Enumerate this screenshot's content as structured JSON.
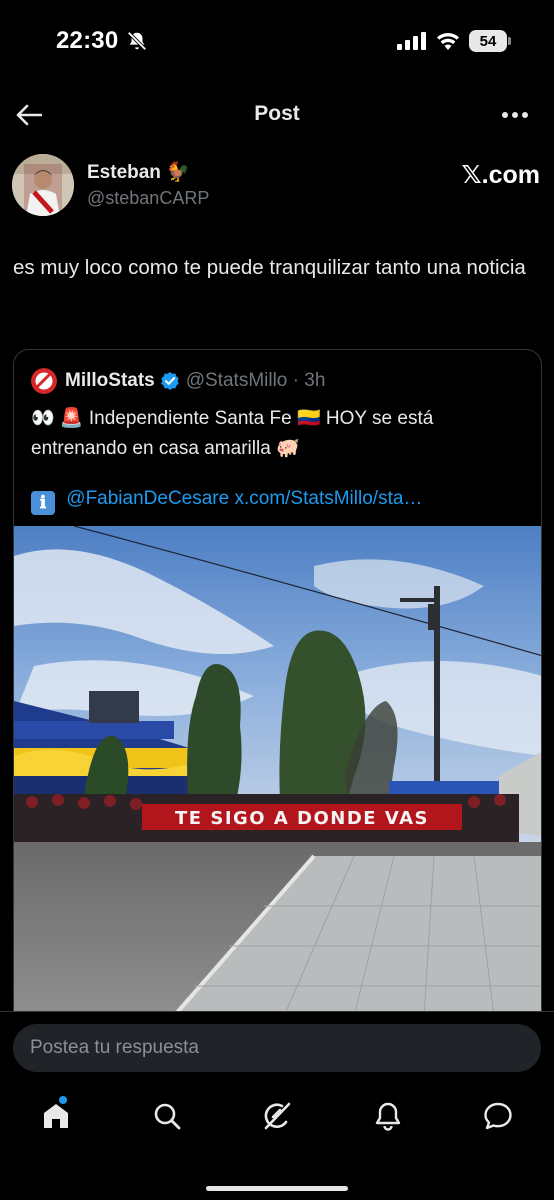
{
  "status_bar": {
    "time": "22:30",
    "battery": "54",
    "icons": [
      "bell-off-icon",
      "signal-icon",
      "wifi-icon",
      "battery-icon"
    ]
  },
  "header": {
    "title": "Post",
    "back_icon": "arrow-left-icon",
    "more_icon": "more-horizontal-icon"
  },
  "post": {
    "author_name": "Esteban 🐓",
    "author_handle": "@stebanCARP",
    "source": "𝕏.com",
    "text": "es muy loco como te puede tranquilizar tanto una noticia"
  },
  "quote": {
    "name": "MilloStats",
    "handle_time": "@StatsMillo · 3h",
    "text": "👀 🚨 Independiente Santa Fe 🇨🇴 HOY se está entrenando en casa amarilla 🐖",
    "info_icon": "ℹ",
    "mention": "@FabianDeCesare",
    "url": "x.com/StatsMillo/sta…",
    "image_banner_text": "TE SIGO A DONDE VAS"
  },
  "reply": {
    "placeholder": "Postea tu respuesta"
  },
  "bottom_nav": [
    "home-icon",
    "search-icon",
    "grok-icon",
    "notifications-icon",
    "messages-icon"
  ],
  "colors": {
    "background": "#000000",
    "text": "#e7e9ea",
    "secondary": "#71767b",
    "link": "#1d9bf0",
    "border": "#333639"
  }
}
